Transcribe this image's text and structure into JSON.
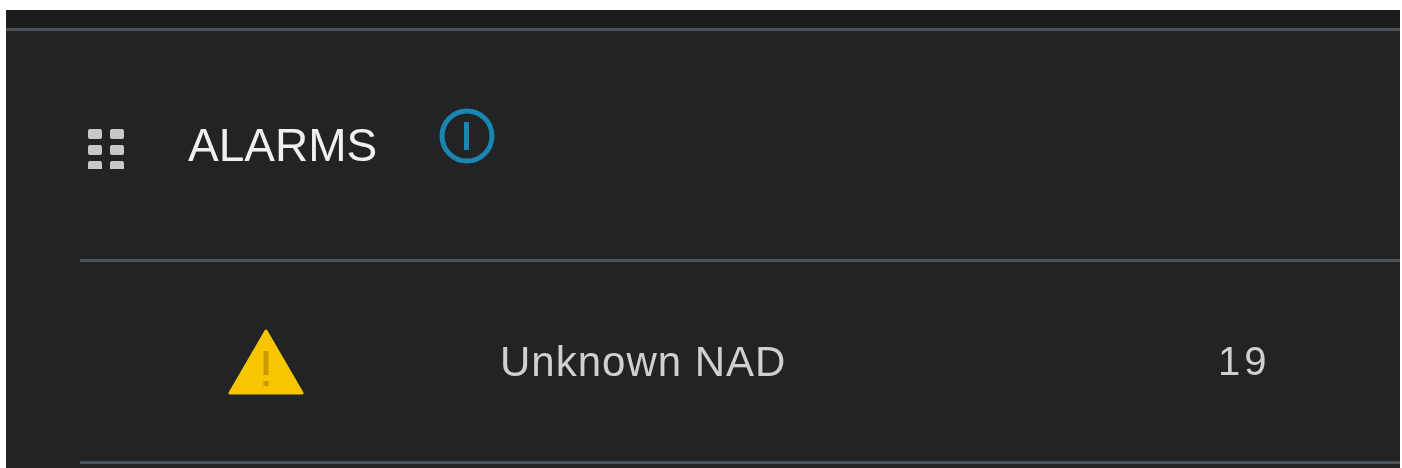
{
  "widget": {
    "title": "ALARMS"
  },
  "alarms": [
    {
      "kind": "warning",
      "name": "Unknown NAD",
      "count": "19"
    }
  ]
}
